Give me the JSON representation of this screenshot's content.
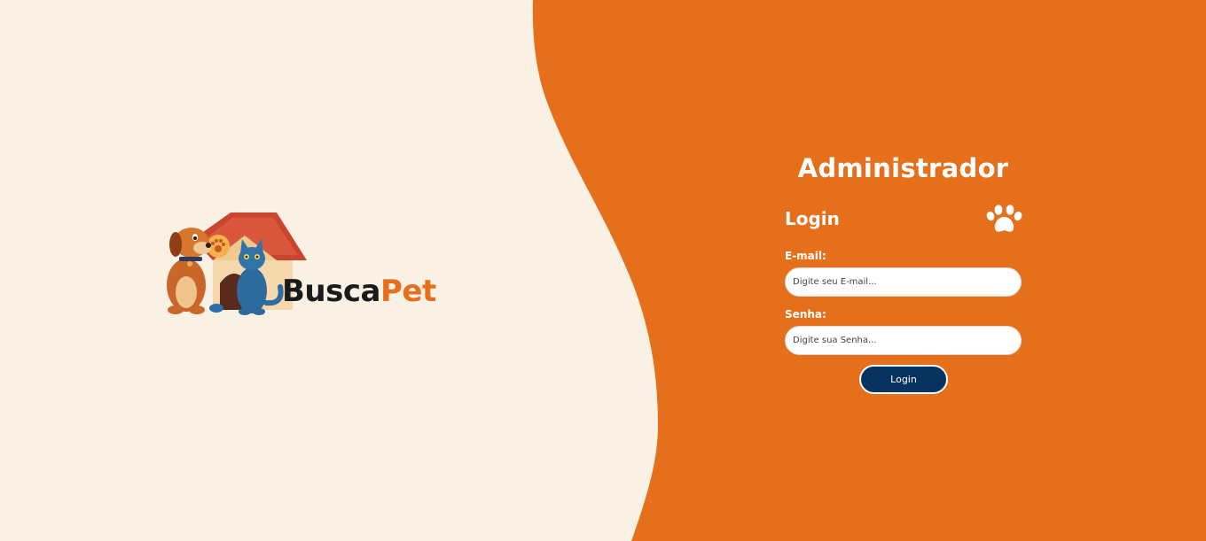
{
  "colors": {
    "background": "#f8f1e4",
    "accent": "#e66f1c",
    "button": "#07315e",
    "text_light": "#ffffff",
    "logo_dark": "#1a1a1a"
  },
  "logo": {
    "part1": "Busca",
    "part2": "Pet",
    "icon": "dog-cat-doghouse-icon"
  },
  "panel": {
    "title": "Administrador",
    "heading": "Login",
    "heading_icon": "paw-icon",
    "email": {
      "label": "E-mail:",
      "placeholder": "Digite seu E-mail...",
      "value": ""
    },
    "senha": {
      "label": "Senha:",
      "placeholder": "Digite sua Senha...",
      "value": ""
    },
    "button_label": "Login"
  }
}
